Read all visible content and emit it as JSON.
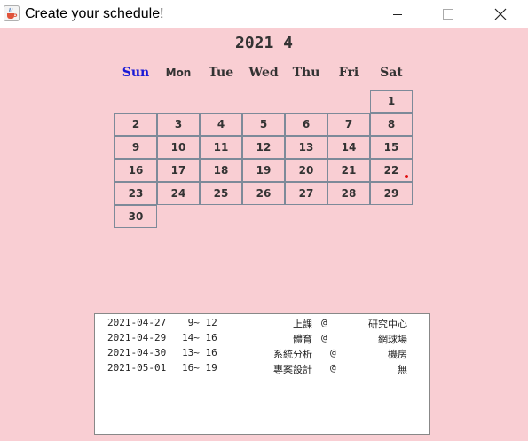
{
  "window": {
    "title": "Create your schedule!",
    "app_icon": "java-cup-icon",
    "controls": [
      "minimize-icon",
      "maximize-icon",
      "close-icon"
    ]
  },
  "calendar": {
    "title": "2021 4",
    "weekdays": [
      "Sun",
      "Mon",
      "Tue",
      "Wed",
      "Thu",
      "Fri",
      "Sat"
    ],
    "days": [
      "1",
      "2",
      "3",
      "4",
      "5",
      "6",
      "7",
      "8",
      "9",
      "10",
      "11",
      "12",
      "13",
      "14",
      "15",
      "16",
      "17",
      "18",
      "19",
      "20",
      "21",
      "22",
      "23",
      "24",
      "25",
      "26",
      "27",
      "28",
      "29",
      "30"
    ],
    "marked_day": "22",
    "sunday_color": "#1a1ad6",
    "marker_color": "#e01010"
  },
  "schedule": [
    {
      "date": "2021-04-27",
      "time": " 9~ 12",
      "course": "上課",
      "at": "@",
      "place": "研究中心"
    },
    {
      "date": "2021-04-29",
      "time": "14~ 16",
      "course": "體育",
      "at": "@",
      "place": "網球場"
    },
    {
      "date": "2021-04-30",
      "time": "13~ 16",
      "course": "系統分析",
      "at": "@",
      "place": "機房"
    },
    {
      "date": "2021-05-01",
      "time": "16~ 19",
      "course": "專案設計",
      "at": "@",
      "place": "無"
    }
  ]
}
